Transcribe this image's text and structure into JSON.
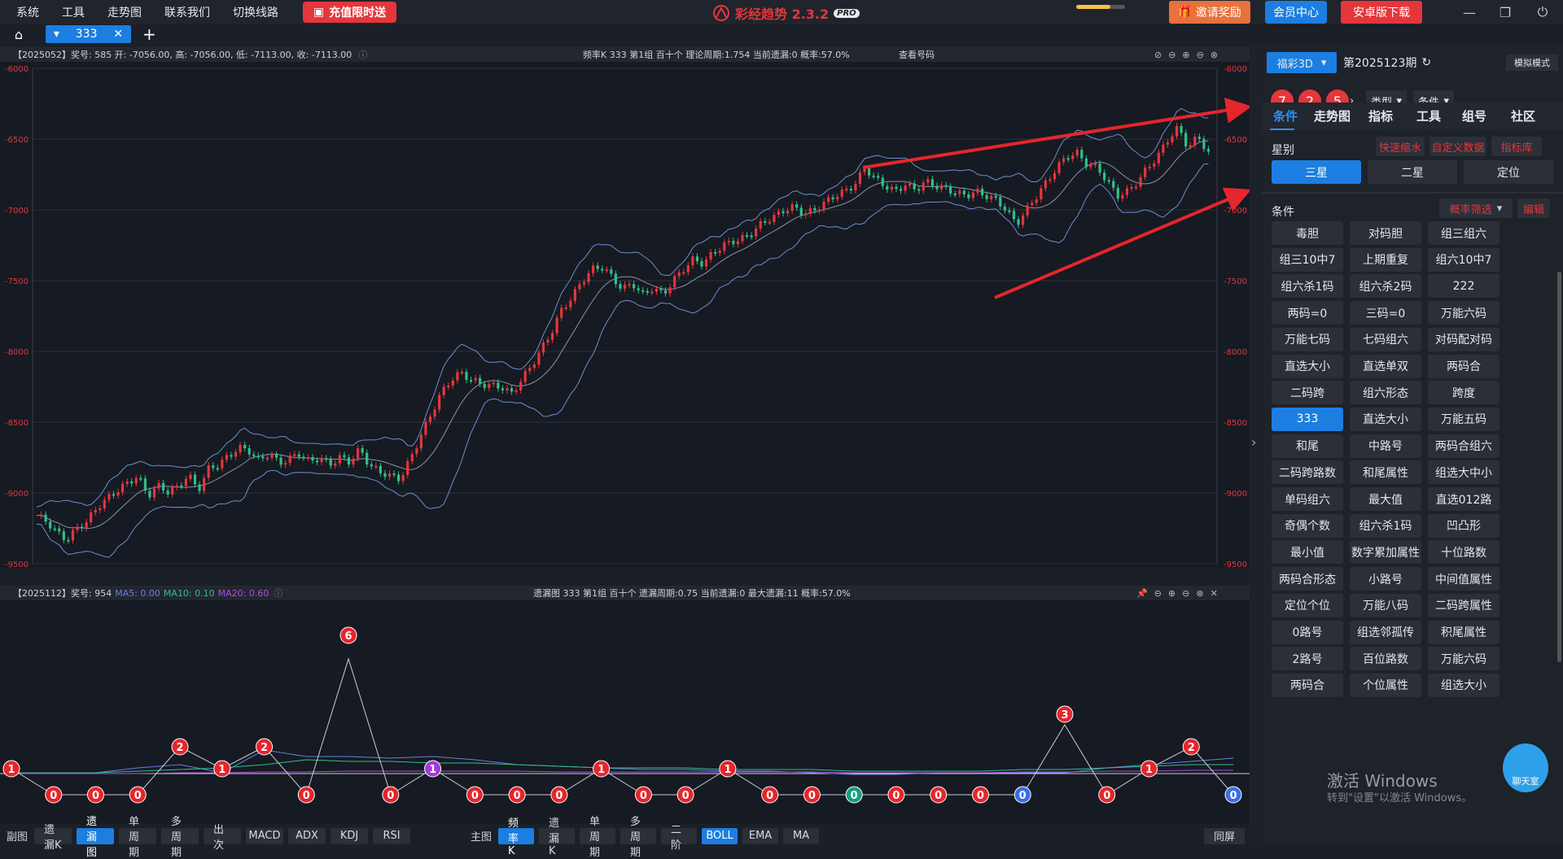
{
  "menu": {
    "items": [
      "系统",
      "工具",
      "走势图",
      "联系我们",
      "切换线路"
    ],
    "promo": "充值限时送"
  },
  "app": {
    "title": "彩经趋势 2.3.2",
    "badge": "PRO"
  },
  "top_right": {
    "invite": "邀请奖励",
    "member": "会员中心",
    "android": "安卓版下载",
    "progress": 0.7
  },
  "tabs": {
    "tab_label": "333"
  },
  "kline_info": {
    "left": "【2025052】奖号: 585  开: -7056.00, 高: -7056.00, 低: -7113.00, 收: -7113.00",
    "center": "频率K  333  第1组  百十个  理论周期:1.754  当前遗漏:0  概率:57.0%",
    "view": "查看号码"
  },
  "miss_info": {
    "left": "【2025112】奖号: 954",
    "ma5": "MA5: 0.00",
    "ma10": "MA10: 0.10",
    "ma20": "MA20: 0.60",
    "center": "遗漏图  333  第1组  百十个  遗漏周期:0.75  当前遗漏:0  最大遗漏:11  概率:57.0%"
  },
  "chart_data": [
    {
      "type": "line",
      "subtype": "candlestick-with-bollinger",
      "ylim": [
        -9500,
        -6000
      ],
      "yticks": [
        "-6000",
        "-6500",
        "-7000",
        "-7500",
        "-8000",
        "-8500",
        "-9000",
        "-9500"
      ],
      "close": [
        -9160,
        -9200,
        -9280,
        -9330,
        -9250,
        -9200,
        -9100,
        -9040,
        -8980,
        -8930,
        -8880,
        -9020,
        -8950,
        -8990,
        -8960,
        -8870,
        -8980,
        -8830,
        -8800,
        -8740,
        -8680,
        -8700,
        -8770,
        -8720,
        -8790,
        -8760,
        -8720,
        -8780,
        -8750,
        -8800,
        -8750,
        -8780,
        -8690,
        -8810,
        -8850,
        -8880,
        -8900,
        -8760,
        -8600,
        -8450,
        -8300,
        -8200,
        -8150,
        -8200,
        -8230,
        -8240,
        -8250,
        -8300,
        -8200,
        -8100,
        -7980,
        -7860,
        -7700,
        -7620,
        -7500,
        -7420,
        -7400,
        -7480,
        -7560,
        -7520,
        -7600,
        -7550,
        -7600,
        -7500,
        -7420,
        -7350,
        -7380,
        -7300,
        -7250,
        -7220,
        -7200,
        -7150,
        -7080,
        -7050,
        -7000,
        -6980,
        -7030,
        -7000,
        -6950,
        -6900,
        -6870,
        -6820,
        -6700,
        -6780,
        -6830,
        -6870,
        -6820,
        -6860,
        -6800,
        -6830,
        -6850,
        -6880,
        -6900,
        -6870,
        -6900,
        -6930,
        -7000,
        -7100,
        -7000,
        -6900,
        -6800,
        -6700,
        -6620,
        -6600,
        -6680,
        -6700,
        -6800,
        -6900,
        -6870,
        -6800,
        -6700,
        -6620,
        -6500,
        -6420,
        -6560,
        -6480,
        -6600
      ],
      "note": "approximate trend; upward channel with two red trend arrows"
    },
    {
      "type": "line",
      "subtype": "omission",
      "series": [
        {
          "name": "MA5",
          "color": "#6d7be8"
        },
        {
          "name": "MA10",
          "color": "#2fc08a"
        },
        {
          "name": "MA20",
          "color": "#b04ce0"
        }
      ],
      "points": [
        1,
        0,
        0,
        0,
        2,
        1,
        2,
        0,
        6,
        0,
        1,
        0,
        0,
        0,
        1,
        0,
        0,
        1,
        0,
        0,
        0,
        0,
        0,
        0,
        0,
        3,
        0,
        1,
        2,
        0
      ],
      "point_colors": [
        "red",
        "red",
        "red",
        "red",
        "red",
        "red",
        "red",
        "red",
        "red",
        "red",
        "purple",
        "red",
        "red",
        "red",
        "red",
        "red",
        "red",
        "red",
        "red",
        "red",
        "green",
        "red",
        "red",
        "red",
        "blue",
        "red",
        "red",
        "red",
        "red",
        "blue"
      ]
    }
  ],
  "bottombar": {
    "left_label": "副图",
    "left": [
      "遗漏K",
      "遗漏图",
      "单周期",
      "多周期",
      "出次",
      "MACD",
      "ADX",
      "KDJ",
      "RSI"
    ],
    "left_active": 1,
    "main_label": "主图",
    "main": [
      "频率K",
      "遗漏K",
      "单周期",
      "多周期",
      "二阶",
      "BOLL",
      "EMA",
      "MA"
    ],
    "main_active": [
      0,
      5
    ],
    "sync": "同屏"
  },
  "right": {
    "lottery": "福彩3D",
    "period": "第2025123期",
    "mode": "模拟模式",
    "balls": [
      "7",
      "2",
      "5"
    ],
    "type_sel": "类型",
    "cond_sel": "条件",
    "navtabs": [
      "条件",
      "走势图",
      "指标",
      "工具",
      "组号",
      "社区"
    ],
    "star_label": "星别",
    "links": [
      "快速缩水",
      "自定义数据",
      "指标库"
    ],
    "stars": [
      "三星",
      "二星",
      "定位"
    ],
    "cond_label": "条件",
    "filter": "概率筛选",
    "edit": "编辑",
    "grid": [
      "毒胆",
      "对码胆",
      "组三组六",
      "组三10中7",
      "上期重复",
      "组六10中7",
      "组六杀1码",
      "组六杀2码",
      "222",
      "两码=0",
      "三码=0",
      "万能六码",
      "万能七码",
      "七码组六",
      "对码配对码",
      "直选大小",
      "直选单双",
      "两码合",
      "二码跨",
      "组六形态",
      "跨度",
      "333",
      "直选大小",
      "万能五码",
      "和尾",
      "中路号",
      "两码合组六",
      "二码跨路数",
      "和尾属性",
      "组选大中小",
      "单码组六",
      "最大值",
      "直选012路",
      "奇偶个数",
      "组六杀1码",
      "凹凸形",
      "最小值",
      "数字累加属性",
      "十位路数",
      "两码合形态",
      "小路号",
      "中间值属性",
      "定位个位",
      "万能八码",
      "二码跨属性",
      "0路号",
      "组选邻孤传",
      "积尾属性",
      "2路号",
      "百位路数",
      "万能六码",
      "两码合",
      "个位属性",
      "组选大小"
    ]
  },
  "watermark": {
    "line1": "激活 Windows",
    "line2": "转到\"设置\"以激活 Windows。"
  },
  "chatbot": "聊天室"
}
